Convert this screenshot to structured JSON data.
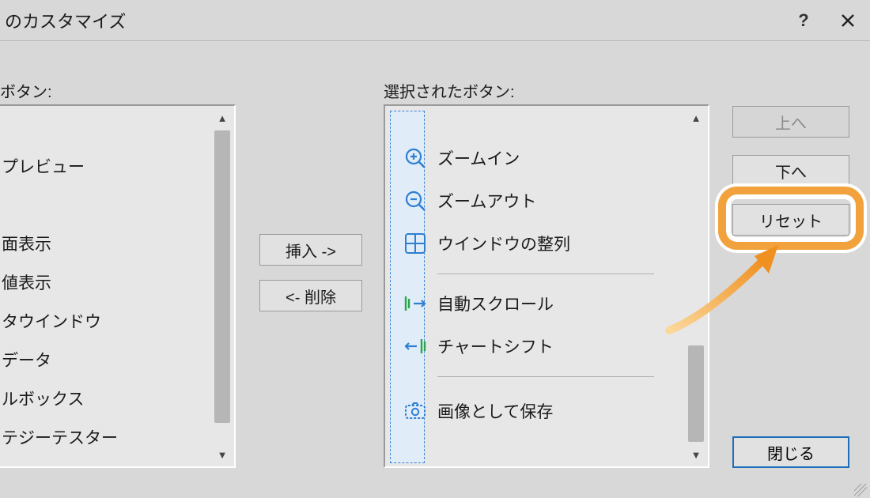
{
  "title": "のカスタマイズ",
  "labels": {
    "left": "ボタン:",
    "right": "選択されたボタン:"
  },
  "left_items": [
    "",
    "プレビュー",
    "",
    "面表示",
    "値表示",
    "タウインドウ",
    "データ",
    "ルボックス",
    "テジーテスター"
  ],
  "right_items": [
    {
      "label": "ズームイン",
      "icon": "zoom-in"
    },
    {
      "label": "ズームアウト",
      "icon": "zoom-out"
    },
    {
      "label": "ウインドウの整列",
      "icon": "tiles"
    },
    {
      "label": "自動スクロール",
      "icon": "autoscroll"
    },
    {
      "label": "チャートシフト",
      "icon": "chartshift"
    },
    {
      "label": "画像として保存",
      "icon": "camera"
    }
  ],
  "buttons": {
    "insert": "挿入 ->",
    "remove": "<- 削除",
    "up": "上へ",
    "down": "下へ",
    "reset": "リセット",
    "close": "閉じる"
  }
}
